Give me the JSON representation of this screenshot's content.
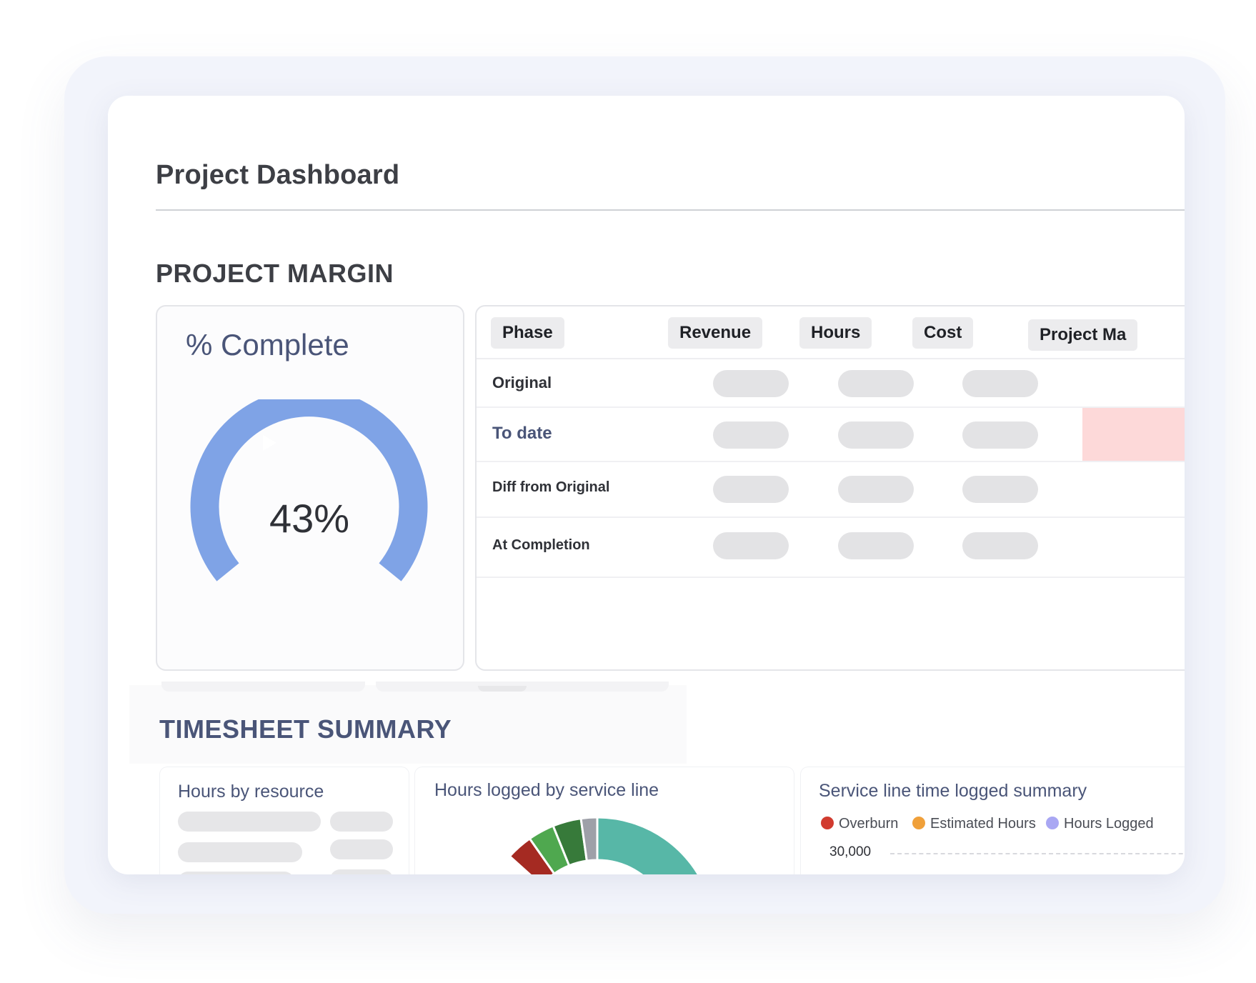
{
  "page": {
    "title": "Project Dashboard"
  },
  "project_margin": {
    "heading": "PROJECT MARGIN",
    "complete_card": {
      "title": "% Complete",
      "value_label": "43%",
      "percent": 43,
      "gauge_color": "#7fa3e6"
    },
    "table": {
      "columns": [
        "Phase",
        "Revenue",
        "Hours",
        "Cost",
        "Project Ma"
      ],
      "rows": [
        {
          "label": "Original"
        },
        {
          "label": "To date"
        },
        {
          "label": "Diff from Original"
        },
        {
          "label": "At Completion"
        }
      ],
      "highlight_color": "#fdd9d9"
    }
  },
  "timesheet_summary": {
    "heading": "TIMESHEET SUMMARY",
    "hours_by_resource": {
      "title": "Hours by resource"
    },
    "hours_by_service_line": {
      "title": "Hours logged by service line",
      "segment_colors": [
        "#a52a22",
        "#4fa84f",
        "#377a3a",
        "#9ea0a8",
        "#57b7a7"
      ]
    },
    "service_line_summary": {
      "title": "Service line time logged summary",
      "legend": [
        {
          "label": "Overburn",
          "color": "#d13b2f"
        },
        {
          "label": "Estimated Hours",
          "color": "#f0a03a"
        },
        {
          "label": "Hours Logged",
          "color": "#a9a7f3"
        }
      ],
      "y_tick": "30,000"
    }
  }
}
